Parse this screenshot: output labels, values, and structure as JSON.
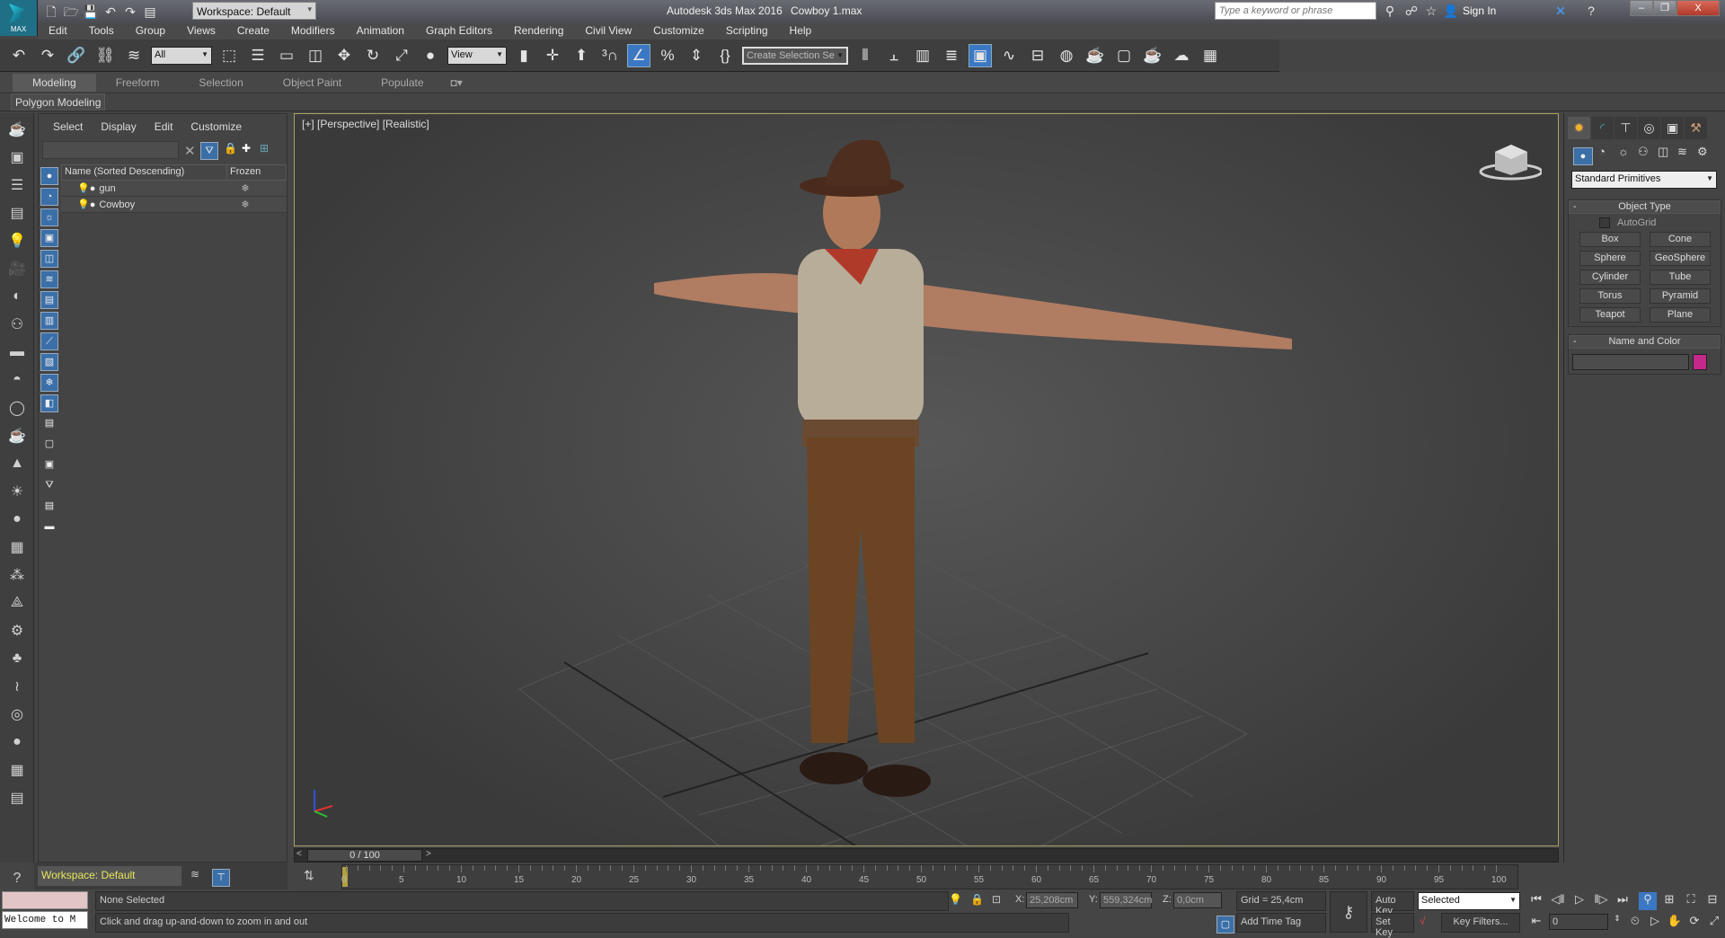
{
  "title_bar": {
    "app_title": "Autodesk 3ds Max 2016",
    "file_name": "Cowboy 1.max",
    "logo_label": "MAX",
    "workspace": "Workspace: Default",
    "search_placeholder": "Type a keyword or phrase",
    "sign_in": "Sign In"
  },
  "menu": [
    "Edit",
    "Tools",
    "Group",
    "Views",
    "Create",
    "Modifiers",
    "Animation",
    "Graph Editors",
    "Rendering",
    "Civil View",
    "Customize",
    "Scripting",
    "Help"
  ],
  "toolbar": {
    "selection_filter": "All",
    "ref_coord": "View",
    "named_selection": "Create Selection Se"
  },
  "ribbon": {
    "tabs": [
      "Modeling",
      "Freeform",
      "Selection",
      "Object Paint",
      "Populate"
    ],
    "active_tab": "Modeling",
    "panel_label": "Polygon Modeling"
  },
  "scene_explorer": {
    "menu": [
      "Select",
      "Display",
      "Edit",
      "Customize"
    ],
    "columns": [
      "Name (Sorted Descending)",
      "Frozen"
    ],
    "rows": [
      {
        "name": "gun"
      },
      {
        "name": "Cowboy"
      }
    ]
  },
  "viewport": {
    "label": "[+] [Perspective] [Realistic]"
  },
  "time_slider": {
    "label": "0 / 100",
    "current": 0,
    "total": 100
  },
  "trackbar": {
    "ticks": [
      "0",
      "5",
      "10",
      "15",
      "20",
      "25",
      "30",
      "35",
      "40",
      "45",
      "50",
      "55",
      "60",
      "65",
      "70",
      "75",
      "80",
      "85",
      "90",
      "95",
      "100"
    ]
  },
  "command_panel": {
    "category": "Standard Primitives",
    "object_type_title": "Object Type",
    "autogrid": "AutoGrid",
    "buttons": [
      "Box",
      "Cone",
      "Sphere",
      "GeoSphere",
      "Cylinder",
      "Tube",
      "Torus",
      "Pyramid",
      "Teapot",
      "Plane"
    ],
    "name_color_title": "Name and Color",
    "object_color": "#c4288a"
  },
  "bottom": {
    "workspace": "Workspace: Default",
    "maxscript": "Welcome to M",
    "selection_status": "None Selected",
    "prompt": "Click and drag up-and-down to zoom in and out",
    "x_label": "X:",
    "x": "25,208cm",
    "y_label": "Y:",
    "y": "559,324cm",
    "z_label": "Z:",
    "z": "0,0cm",
    "grid": "Grid = 25,4cm",
    "add_time_tag": "Add Time Tag",
    "auto_key": "Auto Key",
    "set_key": "Set Key",
    "key_mode": "Selected",
    "key_filters": "Key Filters...",
    "frame": "0"
  }
}
